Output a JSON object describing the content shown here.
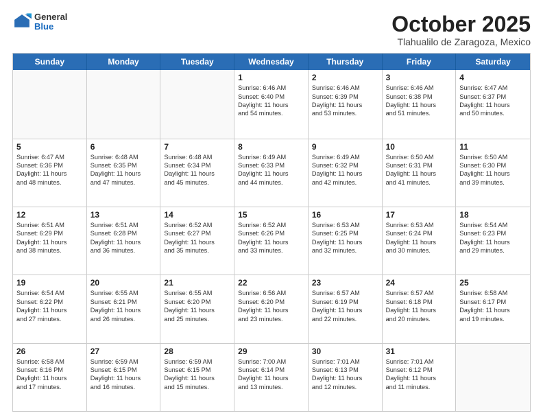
{
  "header": {
    "logo": {
      "general": "General",
      "blue": "Blue"
    },
    "title": "October 2025",
    "location": "Tlahualilo de Zaragoza, Mexico"
  },
  "weekdays": [
    "Sunday",
    "Monday",
    "Tuesday",
    "Wednesday",
    "Thursday",
    "Friday",
    "Saturday"
  ],
  "weeks": [
    [
      {
        "day": "",
        "lines": []
      },
      {
        "day": "",
        "lines": []
      },
      {
        "day": "",
        "lines": []
      },
      {
        "day": "1",
        "lines": [
          "Sunrise: 6:46 AM",
          "Sunset: 6:40 PM",
          "Daylight: 11 hours",
          "and 54 minutes."
        ]
      },
      {
        "day": "2",
        "lines": [
          "Sunrise: 6:46 AM",
          "Sunset: 6:39 PM",
          "Daylight: 11 hours",
          "and 53 minutes."
        ]
      },
      {
        "day": "3",
        "lines": [
          "Sunrise: 6:46 AM",
          "Sunset: 6:38 PM",
          "Daylight: 11 hours",
          "and 51 minutes."
        ]
      },
      {
        "day": "4",
        "lines": [
          "Sunrise: 6:47 AM",
          "Sunset: 6:37 PM",
          "Daylight: 11 hours",
          "and 50 minutes."
        ]
      }
    ],
    [
      {
        "day": "5",
        "lines": [
          "Sunrise: 6:47 AM",
          "Sunset: 6:36 PM",
          "Daylight: 11 hours",
          "and 48 minutes."
        ]
      },
      {
        "day": "6",
        "lines": [
          "Sunrise: 6:48 AM",
          "Sunset: 6:35 PM",
          "Daylight: 11 hours",
          "and 47 minutes."
        ]
      },
      {
        "day": "7",
        "lines": [
          "Sunrise: 6:48 AM",
          "Sunset: 6:34 PM",
          "Daylight: 11 hours",
          "and 45 minutes."
        ]
      },
      {
        "day": "8",
        "lines": [
          "Sunrise: 6:49 AM",
          "Sunset: 6:33 PM",
          "Daylight: 11 hours",
          "and 44 minutes."
        ]
      },
      {
        "day": "9",
        "lines": [
          "Sunrise: 6:49 AM",
          "Sunset: 6:32 PM",
          "Daylight: 11 hours",
          "and 42 minutes."
        ]
      },
      {
        "day": "10",
        "lines": [
          "Sunrise: 6:50 AM",
          "Sunset: 6:31 PM",
          "Daylight: 11 hours",
          "and 41 minutes."
        ]
      },
      {
        "day": "11",
        "lines": [
          "Sunrise: 6:50 AM",
          "Sunset: 6:30 PM",
          "Daylight: 11 hours",
          "and 39 minutes."
        ]
      }
    ],
    [
      {
        "day": "12",
        "lines": [
          "Sunrise: 6:51 AM",
          "Sunset: 6:29 PM",
          "Daylight: 11 hours",
          "and 38 minutes."
        ]
      },
      {
        "day": "13",
        "lines": [
          "Sunrise: 6:51 AM",
          "Sunset: 6:28 PM",
          "Daylight: 11 hours",
          "and 36 minutes."
        ]
      },
      {
        "day": "14",
        "lines": [
          "Sunrise: 6:52 AM",
          "Sunset: 6:27 PM",
          "Daylight: 11 hours",
          "and 35 minutes."
        ]
      },
      {
        "day": "15",
        "lines": [
          "Sunrise: 6:52 AM",
          "Sunset: 6:26 PM",
          "Daylight: 11 hours",
          "and 33 minutes."
        ]
      },
      {
        "day": "16",
        "lines": [
          "Sunrise: 6:53 AM",
          "Sunset: 6:25 PM",
          "Daylight: 11 hours",
          "and 32 minutes."
        ]
      },
      {
        "day": "17",
        "lines": [
          "Sunrise: 6:53 AM",
          "Sunset: 6:24 PM",
          "Daylight: 11 hours",
          "and 30 minutes."
        ]
      },
      {
        "day": "18",
        "lines": [
          "Sunrise: 6:54 AM",
          "Sunset: 6:23 PM",
          "Daylight: 11 hours",
          "and 29 minutes."
        ]
      }
    ],
    [
      {
        "day": "19",
        "lines": [
          "Sunrise: 6:54 AM",
          "Sunset: 6:22 PM",
          "Daylight: 11 hours",
          "and 27 minutes."
        ]
      },
      {
        "day": "20",
        "lines": [
          "Sunrise: 6:55 AM",
          "Sunset: 6:21 PM",
          "Daylight: 11 hours",
          "and 26 minutes."
        ]
      },
      {
        "day": "21",
        "lines": [
          "Sunrise: 6:55 AM",
          "Sunset: 6:20 PM",
          "Daylight: 11 hours",
          "and 25 minutes."
        ]
      },
      {
        "day": "22",
        "lines": [
          "Sunrise: 6:56 AM",
          "Sunset: 6:20 PM",
          "Daylight: 11 hours",
          "and 23 minutes."
        ]
      },
      {
        "day": "23",
        "lines": [
          "Sunrise: 6:57 AM",
          "Sunset: 6:19 PM",
          "Daylight: 11 hours",
          "and 22 minutes."
        ]
      },
      {
        "day": "24",
        "lines": [
          "Sunrise: 6:57 AM",
          "Sunset: 6:18 PM",
          "Daylight: 11 hours",
          "and 20 minutes."
        ]
      },
      {
        "day": "25",
        "lines": [
          "Sunrise: 6:58 AM",
          "Sunset: 6:17 PM",
          "Daylight: 11 hours",
          "and 19 minutes."
        ]
      }
    ],
    [
      {
        "day": "26",
        "lines": [
          "Sunrise: 6:58 AM",
          "Sunset: 6:16 PM",
          "Daylight: 11 hours",
          "and 17 minutes."
        ]
      },
      {
        "day": "27",
        "lines": [
          "Sunrise: 6:59 AM",
          "Sunset: 6:15 PM",
          "Daylight: 11 hours",
          "and 16 minutes."
        ]
      },
      {
        "day": "28",
        "lines": [
          "Sunrise: 6:59 AM",
          "Sunset: 6:15 PM",
          "Daylight: 11 hours",
          "and 15 minutes."
        ]
      },
      {
        "day": "29",
        "lines": [
          "Sunrise: 7:00 AM",
          "Sunset: 6:14 PM",
          "Daylight: 11 hours",
          "and 13 minutes."
        ]
      },
      {
        "day": "30",
        "lines": [
          "Sunrise: 7:01 AM",
          "Sunset: 6:13 PM",
          "Daylight: 11 hours",
          "and 12 minutes."
        ]
      },
      {
        "day": "31",
        "lines": [
          "Sunrise: 7:01 AM",
          "Sunset: 6:12 PM",
          "Daylight: 11 hours",
          "and 11 minutes."
        ]
      },
      {
        "day": "",
        "lines": []
      }
    ]
  ]
}
